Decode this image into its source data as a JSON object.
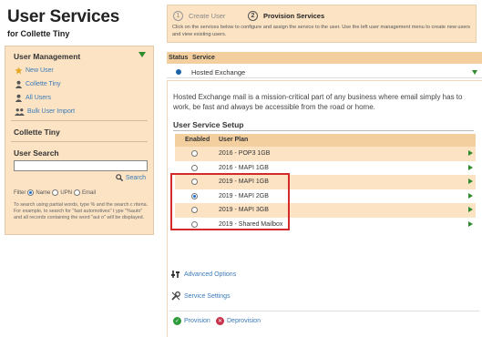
{
  "page": {
    "title": "User Services",
    "subtitle": "for Collette Tiny"
  },
  "left_panel": {
    "header": "User Management",
    "items": [
      {
        "label": "New User",
        "icon": "star-icon"
      },
      {
        "label": "Collette Tiny",
        "icon": "user-icon"
      },
      {
        "label": "All Users",
        "icon": "user-icon"
      },
      {
        "label": "Bulk User Import",
        "icon": "users-icon"
      }
    ],
    "selected_user": "Collette Tiny",
    "search_title": "User Search",
    "search_value": "",
    "search_button": "Search",
    "filter_label": "Filter",
    "filter_options": [
      "Name",
      "UPN",
      "Email"
    ],
    "filter_selected": "Name",
    "help_text": "To search using partial words, type % and the search c riteria. For example, to search for \"fast automotives\" t ype \"%auto\" and all records containing the word \"aut o\" will be displayed."
  },
  "wizard": {
    "steps": [
      {
        "num": "1",
        "label": "Create User",
        "active": false
      },
      {
        "num": "2",
        "label": "Provision Services",
        "active": true
      }
    ],
    "description": "Click on the services below to configure and assign the service to the user. Use the left user management menu to create new users and view existing users."
  },
  "services": {
    "col_status": "Status",
    "col_service": "Service",
    "rows": [
      {
        "name": "Hosted Exchange",
        "status_color": "#1a63a8"
      }
    ]
  },
  "detail": {
    "description": "Hosted Exchange mail is a mission-critical part of any business where email simply has to work, be fast and always be accessible from the road or home.",
    "setup_title": "User Service Setup",
    "col_enabled": "Enabled",
    "col_plan": "User Plan",
    "plans": [
      {
        "name": "2016 - POP3 1GB",
        "selected": false
      },
      {
        "name": "2016 - MAPI 1GB",
        "selected": false
      },
      {
        "name": "2019 - MAPI 1GB",
        "selected": false
      },
      {
        "name": "2019 - MAPI 2GB",
        "selected": true
      },
      {
        "name": "2019 - MAPI 3GB",
        "selected": false
      },
      {
        "name": "2019 - Shared Mailbox",
        "selected": false
      }
    ],
    "advanced_options": "Advanced Options",
    "service_settings": "Service Settings",
    "provision": "Provision",
    "deprovision": "Deprovision"
  },
  "colors": {
    "panel_bg": "#fbe3c4",
    "header_bg": "#f3cf9f",
    "link": "#3a7ab8",
    "accent_green": "#2e8b2e",
    "highlight_red": "#d42a2a"
  }
}
